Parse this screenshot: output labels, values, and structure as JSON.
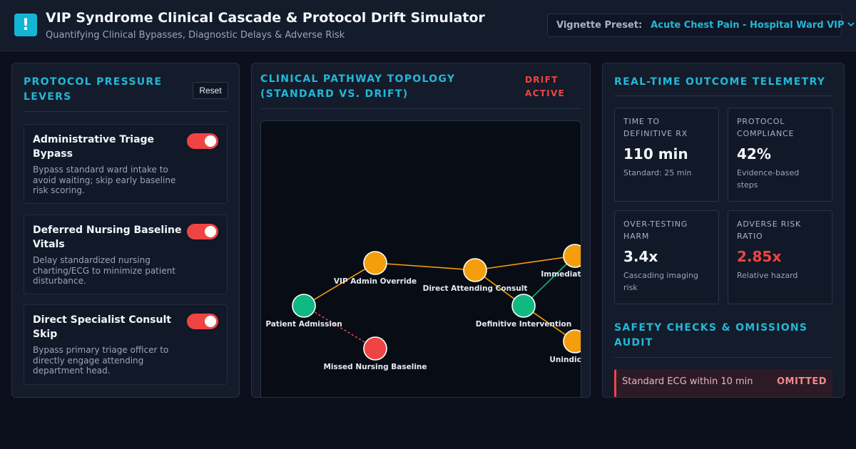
{
  "header": {
    "logo_glyph": "!",
    "title": "VIP Syndrome Clinical Cascade & Protocol Drift Simulator",
    "subtitle": "Quantifying Clinical Bypasses, Diagnostic Delays & Adverse Risk",
    "preset_label": "Vignette Preset:",
    "preset_value": "Acute Chest Pain - Hospital Ward VIP"
  },
  "levers": {
    "title_line1": "PROTOCOL PRESSURE",
    "title_line2": "LEVERS",
    "reset_label": "Reset",
    "items": [
      {
        "title_lines": [
          "Administrative Triage",
          "Bypass"
        ],
        "desc_lines": [
          "Bypass standard ward intake to",
          "avoid waiting; skip early baseline",
          "risk scoring."
        ],
        "enabled": true
      },
      {
        "title_lines": [
          "Deferred Nursing Baseline",
          "Vitals"
        ],
        "desc_lines": [
          "Delay standardized nursing",
          "charting/ECG to minimize patient",
          "disturbance."
        ],
        "enabled": true
      },
      {
        "title_lines": [
          "Direct Specialist Consult",
          "Skip"
        ],
        "desc_lines": [
          "Bypass primary triage officer to",
          "directly engage attending",
          "department head."
        ],
        "enabled": true
      }
    ]
  },
  "pathway": {
    "title_line1": "CLINICAL PATHWAY TOPOLOGY",
    "title_line2": "(STANDARD VS. DRIFT)",
    "badge_line1": "DRIFT",
    "badge_line2": "ACTIVE",
    "colors": {
      "standard": "#10b981",
      "drift": "#f59e0b",
      "omitted": "#ef4444"
    },
    "nodes": [
      {
        "label": "Patient Admission",
        "status": "standard"
      },
      {
        "label": "VIP Admin Override",
        "status": "drift"
      },
      {
        "label": "Direct Attending Consult",
        "status": "drift"
      },
      {
        "label": "Definitive Intervention",
        "status": "standard"
      },
      {
        "label": "Immediate STAT",
        "status": "drift"
      },
      {
        "label": "Unindicated",
        "status": "drift"
      },
      {
        "label": "Missed Nursing Baseline",
        "status": "omitted"
      }
    ]
  },
  "telemetry": {
    "title": "REAL-TIME OUTCOME TELEMETRY",
    "metrics": [
      {
        "label_lines": [
          "TIME TO",
          "DEFINITIVE RX"
        ],
        "value": "110 min",
        "sub_lines": [
          "Standard: 25 min"
        ],
        "alert": false
      },
      {
        "label_lines": [
          "PROTOCOL",
          "COMPLIANCE"
        ],
        "value": "42%",
        "sub_lines": [
          "Evidence-based",
          "steps"
        ],
        "alert": false
      },
      {
        "label_lines": [
          "OVER-TESTING",
          "HARM"
        ],
        "value": "3.4x",
        "sub_lines": [
          "Cascading imaging",
          "risk"
        ],
        "alert": false
      },
      {
        "label_lines": [
          "ADVERSE RISK",
          "RATIO"
        ],
        "value": "2.85x",
        "sub_lines": [
          "Relative hazard"
        ],
        "alert": true
      }
    ]
  },
  "audit": {
    "title_line1": "SAFETY CHECKS & OMISSIONS",
    "title_line2": "AUDIT",
    "items": [
      {
        "text": "Standard ECG within 10 min",
        "status": "OMITTED"
      }
    ]
  }
}
